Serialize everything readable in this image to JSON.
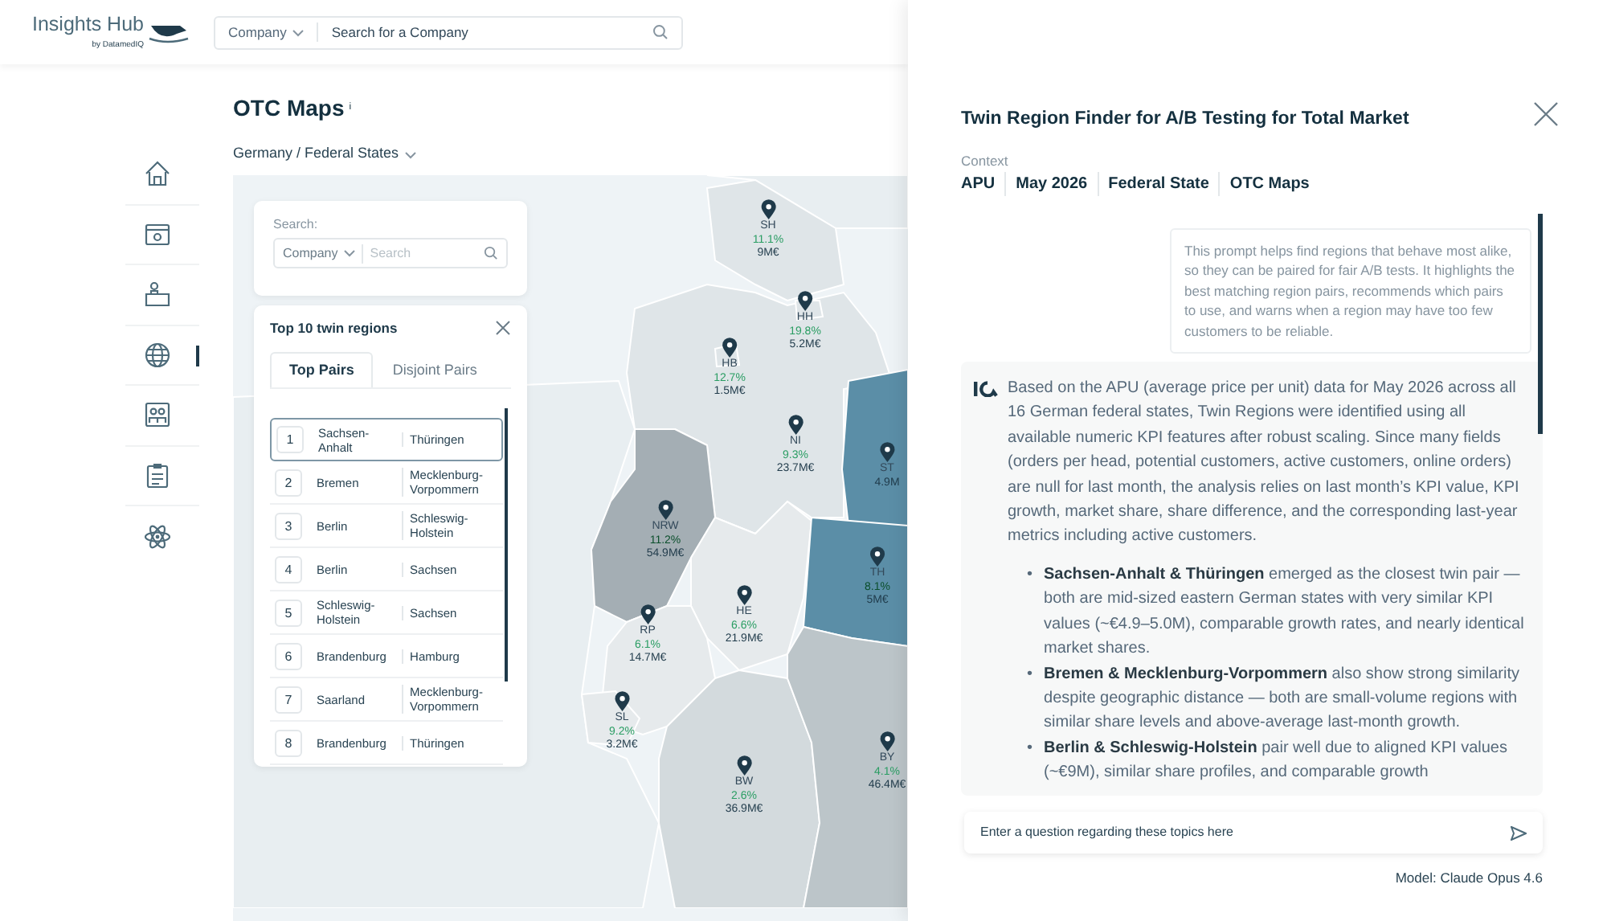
{
  "header": {
    "logo": {
      "name": "Insights Hub",
      "byline": "by DatamedIQ"
    },
    "search": {
      "scope": "Company",
      "placeholder": "Search for a Company"
    }
  },
  "sidebar": {
    "items": [
      {
        "kind": "home",
        "selected": false
      },
      {
        "kind": "window",
        "selected": false
      },
      {
        "kind": "desk",
        "selected": false
      },
      {
        "kind": "globe",
        "selected": true
      },
      {
        "kind": "people",
        "selected": false
      },
      {
        "kind": "clipboard",
        "selected": false
      },
      {
        "kind": "atom",
        "selected": false
      }
    ]
  },
  "page": {
    "title": "OTC Maps",
    "info_mark": "i",
    "breadcrumb": "Germany / Federal States"
  },
  "map": {
    "search": {
      "label": "Search:",
      "scope": "Company",
      "placeholder": "Search"
    },
    "regions": [
      {
        "code": "SH",
        "share": "11.1%",
        "value": "9M€",
        "color": "#dfe5e8"
      },
      {
        "code": "HH",
        "share": "19.8%",
        "value": "5.2M€",
        "color": "#dfe5e8"
      },
      {
        "code": "HB",
        "share": "12.7%",
        "value": "1.5M€",
        "color": "#dfe5e8"
      },
      {
        "code": "NI",
        "share": "9.3%",
        "value": "23.7M€",
        "color": "#dfe5e8"
      },
      {
        "code": "ST",
        "value": "4.9M",
        "color": "#5b8ea7"
      },
      {
        "code": "NRW",
        "share": "11.2%",
        "value": "54.9M€",
        "color": "#a4aeb4"
      },
      {
        "code": "TH",
        "share": "8.1%",
        "value": "5M€",
        "color": "#5b8ea7"
      },
      {
        "code": "HE",
        "share": "6.6%",
        "value": "21.9M€",
        "color": "#e6eaec"
      },
      {
        "code": "RP",
        "share": "6.1%",
        "value": "14.7M€",
        "color": "#e6eaec"
      },
      {
        "code": "SL",
        "share": "9.2%",
        "value": "3.2M€",
        "color": "#e6eaec"
      },
      {
        "code": "BW",
        "share": "2.6%",
        "value": "36.9M€",
        "color": "#d3dadd"
      },
      {
        "code": "BY",
        "share": "4.1%",
        "value": "46.4M€",
        "color": "#bcc5c9"
      }
    ]
  },
  "twin_panel": {
    "title": "Top 10 twin regions",
    "tabs": [
      {
        "label": "Top Pairs",
        "selected": true
      },
      {
        "label": "Disjoint Pairs",
        "selected": false
      }
    ],
    "pairs": [
      {
        "rank": "1",
        "region_a": "Sachsen-Anhalt",
        "region_b": "Thüringen",
        "selected": true
      },
      {
        "rank": "2",
        "region_a": "Bremen",
        "region_b": "Mecklenburg-Vorpommern",
        "selected": false
      },
      {
        "rank": "3",
        "region_a": "Berlin",
        "region_b": "Schleswig-Holstein",
        "selected": false
      },
      {
        "rank": "4",
        "region_a": "Berlin",
        "region_b": "Sachsen",
        "selected": false
      },
      {
        "rank": "5",
        "region_a": "Schleswig-Holstein",
        "region_b": "Sachsen",
        "selected": false
      },
      {
        "rank": "6",
        "region_a": "Brandenburg",
        "region_b": "Hamburg",
        "selected": false
      },
      {
        "rank": "7",
        "region_a": "Saarland",
        "region_b": "Mecklenburg-Vorpommern",
        "selected": false
      },
      {
        "rank": "8",
        "region_a": "Brandenburg",
        "region_b": "Thüringen",
        "selected": false
      }
    ]
  },
  "assistant": {
    "title": "Twin Region Finder for A/B Testing for Total Market",
    "context_label": "Context",
    "context": [
      "APU",
      "May 2026",
      "Federal State",
      "OTC Maps"
    ],
    "prompt": "This prompt helps find regions that behave most alike, so they can be paired for fair A/B tests. It highlights the best matching region pairs, recommends which pairs to use, and warns when a region may have too few customers to be reliable.",
    "answer": {
      "intro": "Based on the APU (average price per unit) data for May 2026 across all 16 German federal states, Twin Regions were identified using all available numeric KPI features after robust scaling. Since many fields (orders per head, potential customers, active customers, online orders) are null for last month, the analysis relies on last month’s KPI value, KPI growth, market share, share difference, and the corresponding last-year metrics including active customers.",
      "bullets": [
        {
          "marker": "•",
          "text": "**Sachsen-Anhalt & Thüringen** emerged as the closest twin pair — both are mid-sized eastern German states with very similar KPI values (~€4.9–5.0M), comparable growth rates, and nearly identical market shares."
        },
        {
          "marker": "•",
          "text": "**Bremen & Mecklenburg-Vorpommern** also show strong similarity despite geographic distance — both are small-volume regions with similar share levels and above-average last-month growth."
        },
        {
          "marker": "•",
          "text": "**Berlin & Schleswig-Holstein** pair well due to aligned KPI values (~€9M), similar share profiles, and comparable growth"
        }
      ]
    },
    "input": {
      "placeholder": "Enter a question regarding these topics here"
    },
    "model": "Model: Claude Opus 4.6"
  }
}
